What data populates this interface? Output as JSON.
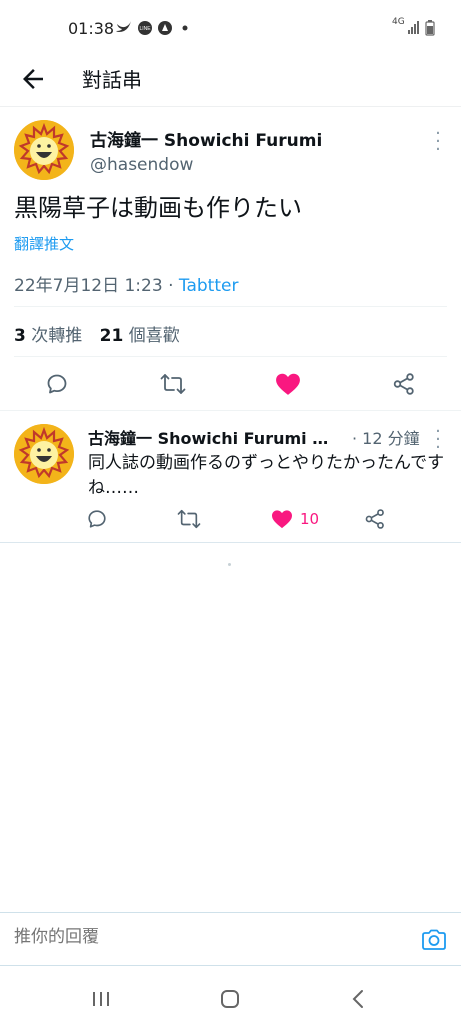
{
  "status_bar": {
    "time": "01:38",
    "network": "4G",
    "left_icons": [
      "twitter-icon",
      "line-icon",
      "app-icon",
      "dot"
    ],
    "right_icons": [
      "signal-icon",
      "battery-icon"
    ]
  },
  "header": {
    "title": "對話串",
    "back_icon": "arrow-left-icon"
  },
  "tweet": {
    "display_name": "古海鐘一 Showichi Furumi",
    "handle": "@hasendow",
    "text": "黒陽草子は動画も作りたい",
    "translate_label": "翻譯推文",
    "timestamp": "22年7月12日 1:23",
    "separator": " · ",
    "source_app": "Tabtter",
    "retweet_count": "3",
    "retweet_label": " 次轉推",
    "like_count": "21",
    "like_label": " 個喜歡",
    "liked": true
  },
  "reply": {
    "display_name": "古海鐘一 Showichi Furumi …",
    "time_ago": "· 12 分鐘",
    "text": "同人誌の動画作るのずっとやりたかったんですね……",
    "like_count": "10",
    "liked": true
  },
  "composer": {
    "placeholder": "推你的回覆",
    "camera_icon": "camera-icon"
  },
  "nav_bar": {
    "icons": [
      "recent-apps-icon",
      "home-icon",
      "back-icon"
    ]
  },
  "colors": {
    "accent": "#1d9bf0",
    "like": "#f91880",
    "avatar": "#f3b41a",
    "text_secondary": "#536471"
  }
}
